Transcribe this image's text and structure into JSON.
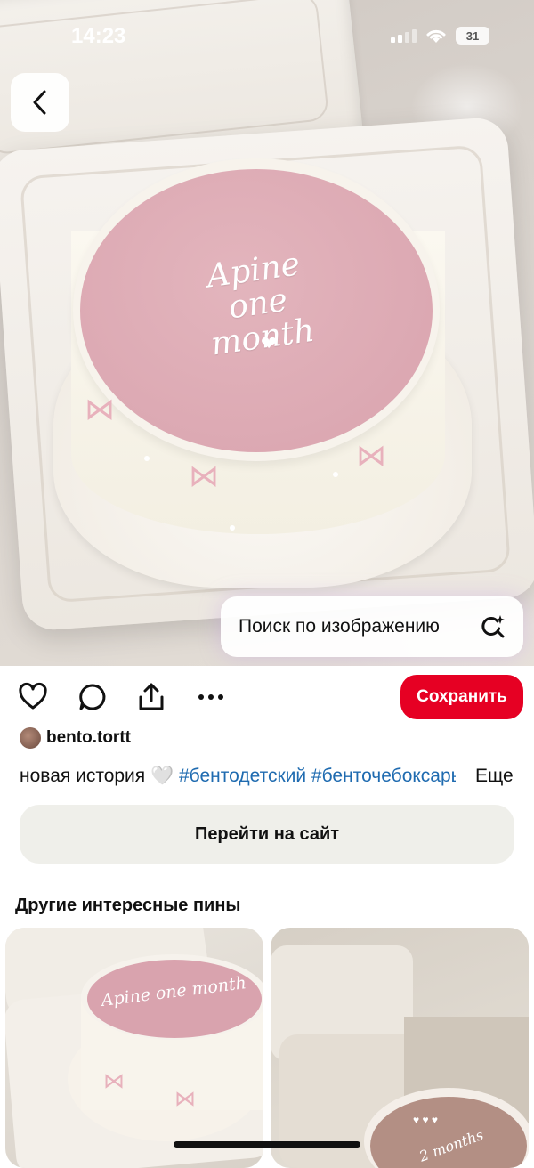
{
  "status_bar": {
    "time": "14:23",
    "battery": "31"
  },
  "hero": {
    "cake_text_line1": "Apine",
    "cake_text_line2": "one month",
    "search_by_image_label": "Поиск по изображению"
  },
  "actions": {
    "save_label": "Сохранить"
  },
  "author": {
    "name": "bento.tortt"
  },
  "description": {
    "text": "новая история 🤍 ",
    "tags": "#бентодетский #бенточебоксары",
    "more_label": "Еще"
  },
  "visit_site_label": "Перейти на сайт",
  "related": {
    "title": "Другие интересные пины",
    "pin1_text": "Apine one month",
    "pin2_text": "2 months"
  }
}
